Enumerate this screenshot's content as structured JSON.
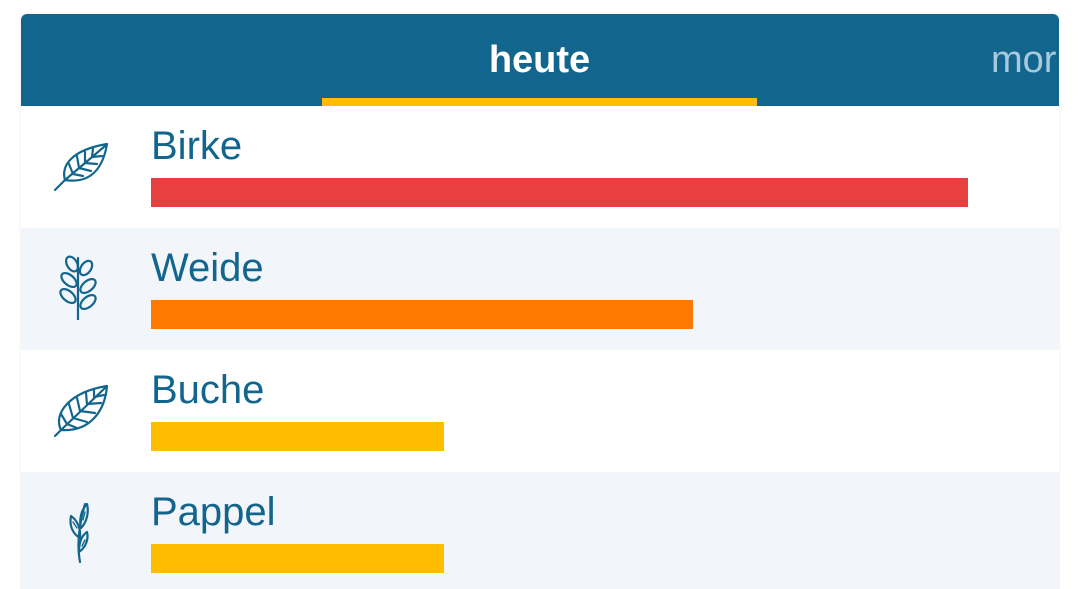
{
  "tabs": {
    "today_label": "heute",
    "tomorrow_label": "mor"
  },
  "pollen": [
    {
      "name": "Birke",
      "icon": "birch-leaf-icon",
      "level": 0.92,
      "color": "#e84040"
    },
    {
      "name": "Weide",
      "icon": "willow-branch-icon",
      "level": 0.61,
      "color": "#ff7800"
    },
    {
      "name": "Buche",
      "icon": "beech-leaf-icon",
      "level": 0.33,
      "color": "#ffbd00"
    },
    {
      "name": "Pappel",
      "icon": "poplar-branch-icon",
      "level": 0.33,
      "color": "#ffbd00"
    }
  ],
  "colors": {
    "header": "#12668e",
    "indicator": "#ffbd00",
    "text": "#12668e"
  }
}
